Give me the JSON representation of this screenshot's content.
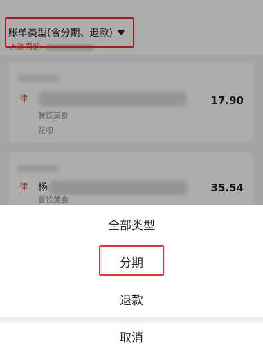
{
  "header": {
    "bill_type_label": "账单类型(含分期、退款)",
    "period_label": "入账周期:"
  },
  "records": [
    {
      "amount": "17.90",
      "category": "餐饮美食",
      "pay_method": "花呗",
      "icon": "merchant-icon"
    },
    {
      "merchant_prefix": "杨",
      "amount": "35.54",
      "category": "餐饮美食",
      "icon": "merchant-icon"
    }
  ],
  "action_sheet": {
    "options": [
      "全部类型",
      "分期",
      "退款"
    ],
    "cancel_label": "取消"
  },
  "colors": {
    "highlight": "#e8332b",
    "accent": "#e8553a"
  }
}
